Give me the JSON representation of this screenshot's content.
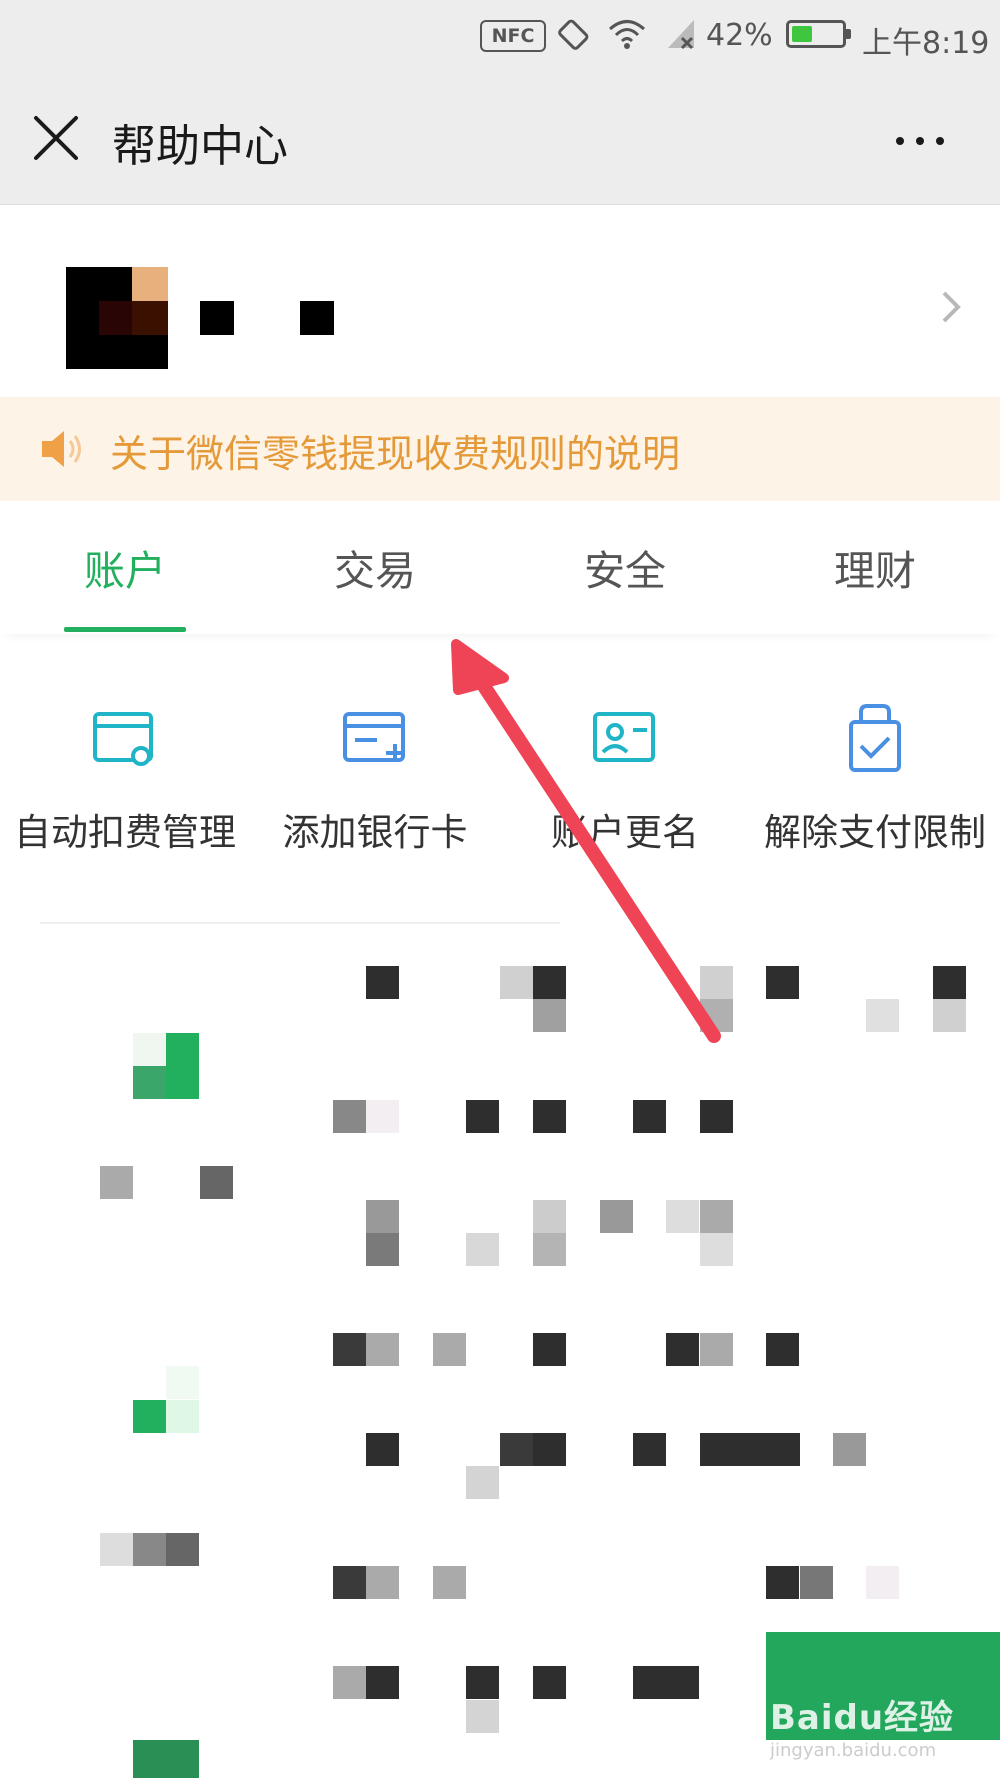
{
  "status_bar": {
    "nfc": "NFC",
    "battery_percent": "42%",
    "battery_level": 0.42,
    "time": "上午8:19",
    "icons": [
      "nfc-icon",
      "screen-rotate-icon",
      "wifi-icon",
      "no-signal-icon",
      "battery-icon"
    ]
  },
  "nav": {
    "close_icon": "close-icon",
    "title": "帮助中心",
    "more_icon": "more-icon"
  },
  "account": {
    "chevron_icon": "chevron-right-icon"
  },
  "notice": {
    "icon": "speaker-icon",
    "text": "关于微信零钱提现收费规则的说明",
    "color": "#e59a3a"
  },
  "tabs": [
    {
      "label": "账户",
      "active": true
    },
    {
      "label": "交易",
      "active": false
    },
    {
      "label": "安全",
      "active": false
    },
    {
      "label": "理财",
      "active": false
    }
  ],
  "accent_color": "#23b05e",
  "actions": [
    {
      "label": "自动扣费管理",
      "icon": "auto-deduct-icon"
    },
    {
      "label": "添加银行卡",
      "icon": "add-card-icon"
    },
    {
      "label": "账户更名",
      "icon": "rename-account-icon"
    },
    {
      "label": "解除支付限制",
      "icon": "unlock-payment-icon"
    }
  ],
  "watermark": {
    "text": "Baidu经验",
    "url": "jingyan.baidu.com"
  }
}
